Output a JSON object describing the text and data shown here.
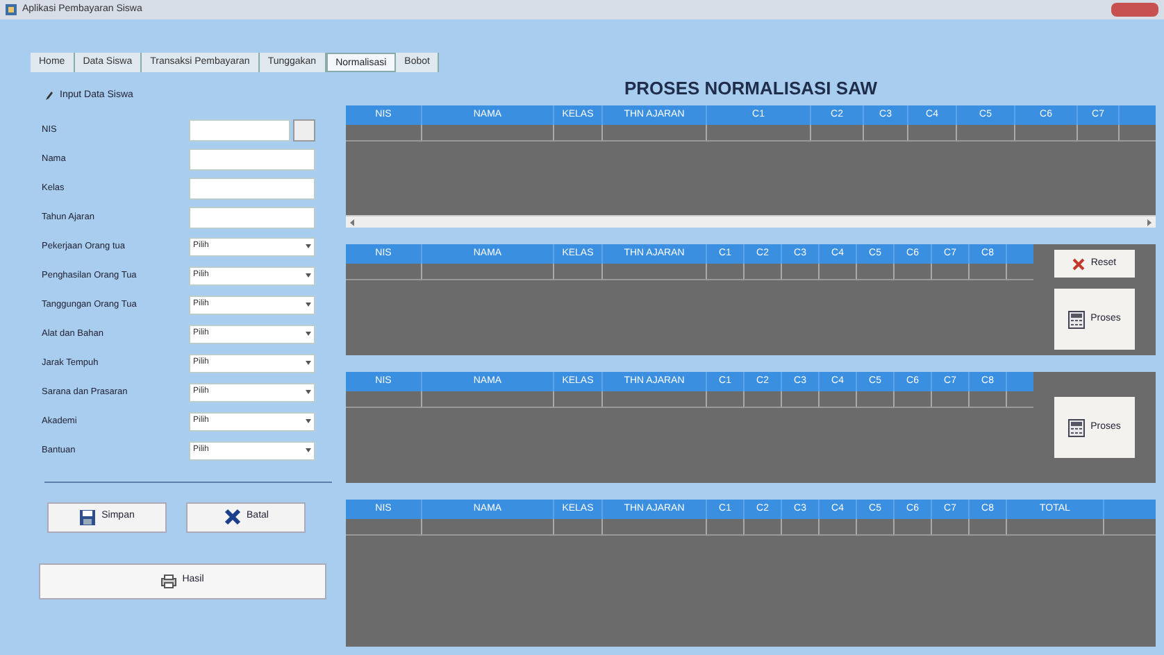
{
  "window": {
    "title": "Aplikasi Pembayaran Siswa"
  },
  "tabs": [
    {
      "label": "Home",
      "selected": false
    },
    {
      "label": "Data Siswa",
      "selected": false
    },
    {
      "label": "Transaksi Pembayaran",
      "selected": false
    },
    {
      "label": "Tunggakan",
      "selected": false
    },
    {
      "label": "Normalisasi",
      "selected": true
    },
    {
      "label": "Bobot",
      "selected": false
    }
  ],
  "form": {
    "title": "Input Data Siswa",
    "fields": [
      {
        "label": "NIS",
        "kind": "lookup"
      },
      {
        "label": "Nama",
        "kind": "text"
      },
      {
        "label": "Kelas",
        "kind": "text"
      },
      {
        "label": "Tahun Ajaran",
        "kind": "text"
      },
      {
        "label": "Pekerjaan Orang tua",
        "kind": "select",
        "value": "Pilih"
      },
      {
        "label": "Penghasilan Orang Tua",
        "kind": "select",
        "value": "Pilih"
      },
      {
        "label": "Tanggungan Orang Tua",
        "kind": "select",
        "value": "Pilih"
      },
      {
        "label": "Alat dan Bahan",
        "kind": "select",
        "value": "Pilih"
      },
      {
        "label": "Jarak Tempuh",
        "kind": "select",
        "value": "Pilih"
      },
      {
        "label": "Sarana dan Prasaran",
        "kind": "select",
        "value": "Pilih"
      },
      {
        "label": "Akademi",
        "kind": "select",
        "value": "Pilih"
      },
      {
        "label": "Bantuan",
        "kind": "select",
        "value": "Pilih"
      }
    ],
    "buttons": [
      {
        "label": "Simpan",
        "kind": "save"
      },
      {
        "label": "Batal",
        "kind": "cancel"
      }
    ],
    "result_button": "Hasil"
  },
  "heading": "PROSES NORMALISASI SAW",
  "tables": [
    {
      "columns": [
        "NIS",
        "NAMA",
        "KELAS",
        "THN AJARAN",
        "C1",
        "C2",
        "C3",
        "C4",
        "C5",
        "C6",
        "C7"
      ],
      "scrollbar": true
    },
    {
      "columns": [
        "NIS",
        "NAMA",
        "KELAS",
        "THN AJARAN",
        "C1",
        "C2",
        "C3",
        "C4",
        "C5",
        "C6",
        "C7",
        "C8"
      ],
      "buttons": [
        {
          "label": "Reset",
          "kind": "reset"
        },
        {
          "label": "Proses",
          "kind": "process"
        }
      ]
    },
    {
      "columns": [
        "NIS",
        "NAMA",
        "KELAS",
        "THN AJARAN",
        "C1",
        "C2",
        "C3",
        "C4",
        "C5",
        "C6",
        "C7",
        "C8"
      ],
      "buttons": [
        {
          "label": "Proses",
          "kind": "process"
        }
      ]
    },
    {
      "columns": [
        "NIS",
        "NAMA",
        "KELAS",
        "THN AJARAN",
        "C1",
        "C2",
        "C3",
        "C4",
        "C5",
        "C6",
        "C7",
        "C8",
        "TOTAL"
      ]
    }
  ]
}
